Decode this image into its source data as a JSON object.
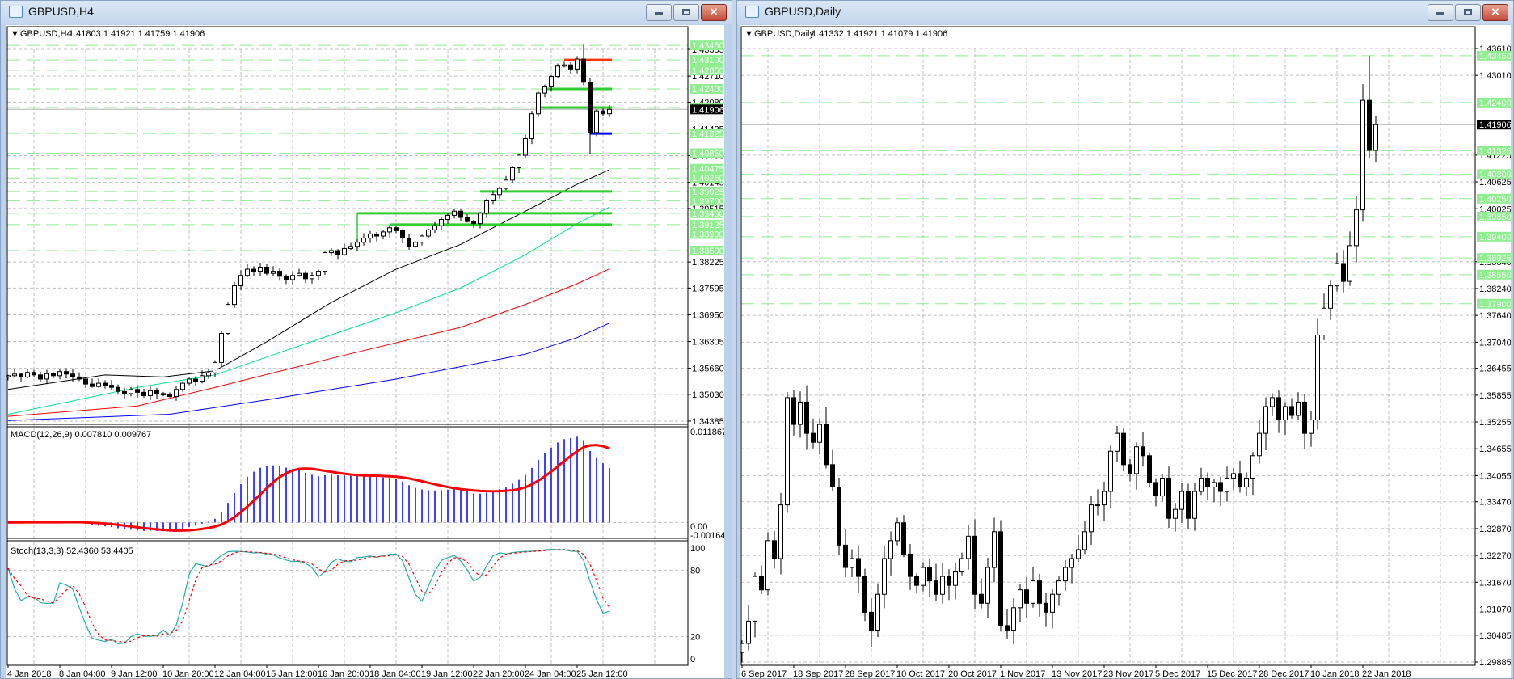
{
  "left": {
    "title": "GBPUSD,H4",
    "header_symbol": "GBPUSD,H4",
    "header_ohlc": "1.41803 1.41921 1.41759 1.41906",
    "price_ticks": [
      "1.43355",
      "1.42710",
      "1.42080",
      "1.41435",
      "1.40790",
      "1.40145",
      "1.39515",
      "1.38225",
      "1.37595",
      "1.36950",
      "1.36305",
      "1.35660",
      "1.35030",
      "1.34385"
    ],
    "level_labels": [
      "1.43450",
      "1.43100",
      "1.42850",
      "1.42400",
      "1.41950",
      "1.41325",
      "1.40850",
      "1.40475",
      "1.40250",
      "1.39925",
      "1.39700",
      "1.39400",
      "1.39125",
      "1.38900",
      "1.38500"
    ],
    "current_price": "1.41906",
    "time_labels": [
      "4 Jan 2018",
      "8 Jan 04:00",
      "9 Jan 12:00",
      "10 Jan 20:00",
      "12 Jan 04:00",
      "15 Jan 12:00",
      "16 Jan 20:00",
      "18 Jan 04:00",
      "19 Jan 12:00",
      "22 Jan 20:00",
      "24 Jan 04:00",
      "25 Jan 12:00"
    ],
    "macd": {
      "label": "MACD(12,26,9) 0.007810 0.009767",
      "max_label": "0.011867",
      "zero_label": "0.00",
      "min_label": "-0.001648"
    },
    "stoch": {
      "label": "Stoch(13,3,3) 52.4360 53.4405",
      "ticks": [
        "100",
        "80",
        "20",
        "0"
      ]
    }
  },
  "right": {
    "title": "GBPUSD,Daily",
    "header_symbol": "GBPUSD,Daily",
    "header_ohlc": "1.41332 1.41921 1.41079 1.41906",
    "price_ticks": [
      "1.43610",
      "1.43010",
      "1.41225",
      "1.40625",
      "1.40025",
      "1.38840",
      "1.38240",
      "1.37640",
      "1.37040",
      "1.36455",
      "1.35855",
      "1.35255",
      "1.34655",
      "1.34055",
      "1.33470",
      "1.32870",
      "1.32270",
      "1.31670",
      "1.31070",
      "1.30485",
      "1.29885"
    ],
    "level_labels": [
      "1.43450",
      "1.42400",
      "1.41325",
      "1.40800",
      "1.40250",
      "1.39850",
      "1.39400",
      "1.38925",
      "1.38550",
      "1.37900"
    ],
    "current_price": "1.41906",
    "time_labels": [
      "6 Sep 2017",
      "18 Sep 2017",
      "28 Sep 2017",
      "10 Oct 2017",
      "20 Oct 2017",
      "1 Nov 2017",
      "13 Nov 2017",
      "23 Nov 2017",
      "5 Dec 2017",
      "15 Dec 2017",
      "28 Dec 2017",
      "10 Jan 2018",
      "22 Jan 2018"
    ]
  },
  "colors": {
    "level": "#90ee90",
    "level_text": "#f4fff4",
    "bull": "#ffffff",
    "bear": "#000000",
    "macd": "#0000ff",
    "signal": "#ff0000",
    "stoch_main": "#20b2aa",
    "grid": "#c0c0c0"
  },
  "chart_data": [
    {
      "type": "candlestick",
      "title": "GBPUSD,H4",
      "ylim": [
        1.34385,
        1.43355
      ],
      "label_every_bars": 8,
      "first_open": 1.3545,
      "closes": [
        1.3548,
        1.3552,
        1.3545,
        1.3556,
        1.355,
        1.354,
        1.3553,
        1.3548,
        1.3558,
        1.3552,
        1.3545,
        1.354,
        1.3528,
        1.3522,
        1.353,
        1.3525,
        1.352,
        1.351,
        1.3505,
        1.3515,
        1.3508,
        1.35,
        1.3512,
        1.3505,
        1.3502,
        1.3498,
        1.3515,
        1.353,
        1.354,
        1.3535,
        1.3548,
        1.3555,
        1.358,
        1.365,
        1.372,
        1.3765,
        1.379,
        1.3805,
        1.38,
        1.381,
        1.3795,
        1.38,
        1.3788,
        1.378,
        1.379,
        1.3795,
        1.3782,
        1.379,
        1.38,
        1.3845,
        1.385,
        1.384,
        1.3855,
        1.386,
        1.387,
        1.388,
        1.389,
        1.3885,
        1.3895,
        1.3905,
        1.3898,
        1.388,
        1.386,
        1.387,
        1.3885,
        1.39,
        1.391,
        1.3925,
        1.3935,
        1.3945,
        1.393,
        1.392,
        1.3915,
        1.394,
        1.397,
        1.3985,
        1.4,
        1.402,
        1.405,
        1.408,
        1.412,
        1.418,
        1.423,
        1.4245,
        1.427,
        1.4295,
        1.4298,
        1.4288,
        1.4312,
        1.4256,
        1.4135,
        1.4187,
        1.418,
        1.41906
      ],
      "wick": 0.0012,
      "extremes": [
        {
          "bar": 89,
          "high": 1.4347
        },
        {
          "bar": 90,
          "low": 1.4082
        }
      ],
      "moving_averages": [
        {
          "color": "#000000",
          "points": [
            [
              0,
              1.3515
            ],
            [
              15,
              1.355
            ],
            [
              24,
              1.3545
            ],
            [
              32,
              1.356
            ],
            [
              40,
              1.363
            ],
            [
              50,
              1.3725
            ],
            [
              60,
              1.3805
            ],
            [
              70,
              1.3865
            ],
            [
              80,
              1.3945
            ],
            [
              88,
              1.401
            ],
            [
              93,
              1.4045
            ]
          ]
        },
        {
          "color": "#00e68a",
          "points": [
            [
              0,
              1.3455
            ],
            [
              20,
              1.352
            ],
            [
              32,
              1.355
            ],
            [
              45,
              1.362
            ],
            [
              60,
              1.37
            ],
            [
              70,
              1.376
            ],
            [
              80,
              1.384
            ],
            [
              88,
              1.3915
            ],
            [
              93,
              1.3955
            ]
          ]
        },
        {
          "color": "#ff0000",
          "points": [
            [
              0,
              1.345
            ],
            [
              20,
              1.3475
            ],
            [
              32,
              1.352
            ],
            [
              50,
              1.359
            ],
            [
              70,
              1.3665
            ],
            [
              80,
              1.372
            ],
            [
              88,
              1.377
            ],
            [
              93,
              1.3806
            ]
          ]
        },
        {
          "color": "#0000ff",
          "points": [
            [
              0,
              1.344
            ],
            [
              25,
              1.3455
            ],
            [
              40,
              1.349
            ],
            [
              60,
              1.354
            ],
            [
              80,
              1.36
            ],
            [
              88,
              1.364
            ],
            [
              93,
              1.3675
            ]
          ]
        }
      ],
      "trend_levels": [
        {
          "price": 1.431,
          "from_bar": 86,
          "color": "#ff3300"
        },
        {
          "price": 1.424,
          "from_bar": 83,
          "color": "#33cc33"
        },
        {
          "price": 1.4195,
          "from_bar": 82,
          "color": "#33cc33"
        },
        {
          "price": 1.41325,
          "from_bar": 90,
          "color": "#0000ff"
        },
        {
          "price": 1.39925,
          "from_bar": 73,
          "color": "#33cc33"
        },
        {
          "price": 1.394,
          "from_bar": 54,
          "color": "#33cc33",
          "drop_to": 1.3855
        },
        {
          "price": 1.39125,
          "from_bar": 59,
          "color": "#33cc33",
          "drop_to": 1.388
        }
      ],
      "macd_range": [
        -0.001648,
        0.011867
      ],
      "stoch_range": [
        0,
        100
      ]
    },
    {
      "type": "candlestick",
      "title": "GBPUSD,Daily",
      "ylim": [
        1.29885,
        1.4361
      ],
      "label_every_bars": 8,
      "first_open": 1.301,
      "closes": [
        1.303,
        1.308,
        1.318,
        1.315,
        1.326,
        1.322,
        1.334,
        1.358,
        1.352,
        1.357,
        1.35,
        1.348,
        1.352,
        1.343,
        1.338,
        1.325,
        1.32,
        1.322,
        1.318,
        1.31,
        1.306,
        1.314,
        1.322,
        1.326,
        1.33,
        1.323,
        1.318,
        1.316,
        1.32,
        1.317,
        1.314,
        1.318,
        1.316,
        1.319,
        1.322,
        1.327,
        1.314,
        1.312,
        1.32,
        1.328,
        1.307,
        1.306,
        1.311,
        1.315,
        1.312,
        1.317,
        1.312,
        1.31,
        1.314,
        1.317,
        1.32,
        1.322,
        1.324,
        1.328,
        1.334,
        1.334,
        1.337,
        1.346,
        1.35,
        1.343,
        1.341,
        1.347,
        1.345,
        1.339,
        1.336,
        1.34,
        1.331,
        1.333,
        1.337,
        1.331,
        1.337,
        1.34,
        1.338,
        1.339,
        1.337,
        1.34,
        1.341,
        1.338,
        1.34,
        1.345,
        1.35,
        1.356,
        1.358,
        1.353,
        1.356,
        1.354,
        1.357,
        1.35,
        1.353,
        1.372,
        1.378,
        1.383,
        1.388,
        1.384,
        1.392,
        1.4,
        1.4245,
        1.41332,
        1.41906
      ],
      "wick": 0.0035,
      "extremes": [
        {
          "bar": 97,
          "high": 1.4345
        },
        {
          "bar": 98,
          "low": 1.41079,
          "high": 1.421
        }
      ]
    }
  ]
}
